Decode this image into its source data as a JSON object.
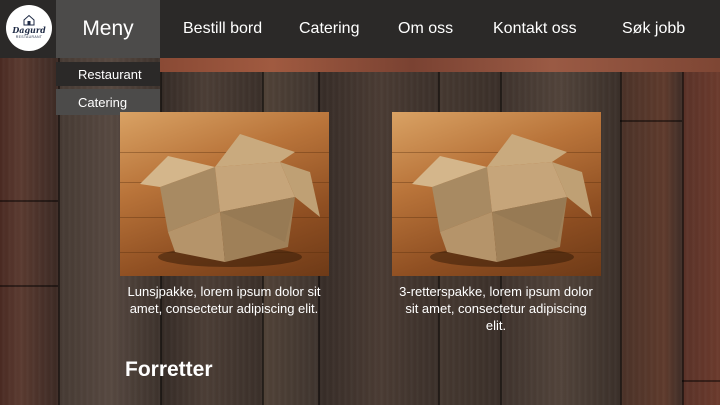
{
  "brand": {
    "name": "Dagurd",
    "tagline": "RESTAURANT"
  },
  "nav": {
    "menu_label": "Meny",
    "items": [
      "Bestill bord",
      "Catering",
      "Om oss",
      "Kontakt oss",
      "Søk jobb"
    ]
  },
  "dropdown": {
    "items": [
      "Restaurant",
      "Catering"
    ],
    "active": "Catering"
  },
  "cards": [
    {
      "caption": "Lunsjpakke, lorem ipsum dolor sit amet, consectetur adipiscing elit.",
      "icon": "cardboard-box"
    },
    {
      "caption": "3-retterspakke, lorem ipsum dolor sit amet, consectetur adipiscing elit.",
      "icon": "cardboard-box"
    }
  ],
  "section": {
    "title": "Forretter"
  },
  "colors": {
    "topbar": "#2b2928",
    "active_tab": "#4c4b4a",
    "accent_strip": "#8a4a35",
    "logo_text": "#1e2a44"
  }
}
